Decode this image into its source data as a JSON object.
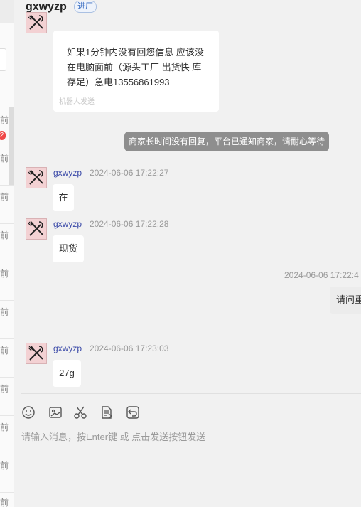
{
  "header": {
    "shop_name": "gxwyzp",
    "tag": "进厂"
  },
  "left_list": {
    "time_label": "前",
    "unread_count": "2"
  },
  "messages": [
    {
      "type": "auto",
      "text_lines": [
        "如果1分钟内没有回您信息 应该没",
        "在电脑面前（源头工厂 出货快  库",
        "存足）急电13556861993"
      ],
      "note": "机器人发送"
    },
    {
      "type": "system",
      "text": "商家长时间没有回复，平台已通知商家，请耐心等待"
    },
    {
      "type": "incoming",
      "sender": "gxwyzp",
      "time": "2024-06-06 17:22:27",
      "text": "在"
    },
    {
      "type": "incoming",
      "sender": "gxwyzp",
      "time": "2024-06-06 17:22:28",
      "text": "现货"
    },
    {
      "type": "outgoing",
      "time": "2024-06-06 17:22:4",
      "text": "请问重"
    },
    {
      "type": "incoming",
      "sender": "gxwyzp",
      "time": "2024-06-06 17:23:03",
      "text": "27g"
    }
  ],
  "toolbar": {
    "icons": [
      "emoji-icon",
      "image-icon",
      "scissors-icon",
      "document-icon",
      "history-icon"
    ]
  },
  "composer": {
    "placeholder": "请输入消息，按Enter键 或 点击发送按钮发送"
  },
  "colors": {
    "accent": "#3b4aa8",
    "system_bubble": "#8e8e8e",
    "badge": "#f04848"
  }
}
